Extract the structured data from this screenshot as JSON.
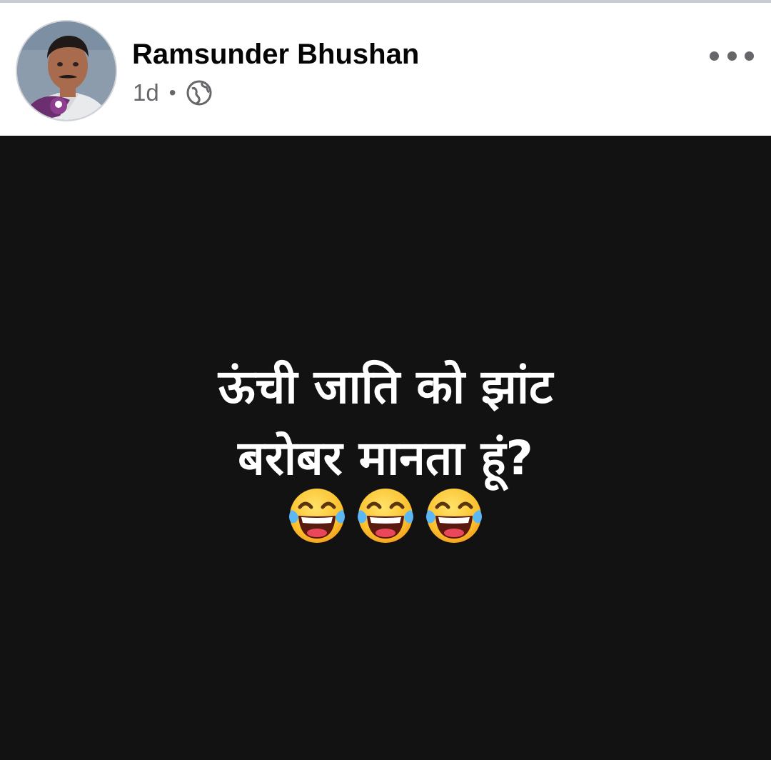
{
  "post": {
    "author": "Ramsunder Bhushan",
    "time": "1d",
    "separator": "•",
    "audience_icon": "globe-icon",
    "more_icon": "more-options-icon",
    "text_line1": "ऊंची जाति को झांट",
    "text_line2": "बरोबर मानता हूं?",
    "emoji_icon": "face-with-tears-of-joy-icon",
    "emoji_count": 3,
    "background_color": "#121212",
    "text_color": "#ffffff"
  }
}
